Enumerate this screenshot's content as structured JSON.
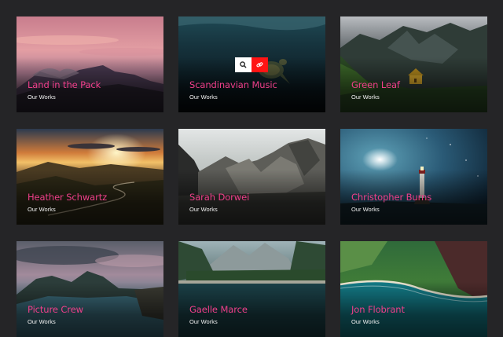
{
  "colors": {
    "background": "#252527",
    "title": "#ef3f8a",
    "subtitle": "#f2f2f2",
    "link_button": "#ff1414"
  },
  "portfolio": {
    "items": [
      {
        "title": "Land in the Pack",
        "category": "Our Works",
        "image": "pink-sunset-mountains"
      },
      {
        "title": "Scandinavian Music",
        "category": "Our Works",
        "image": "sea-turtle-underwater",
        "hover_actions": [
          "search-icon",
          "link-icon"
        ]
      },
      {
        "title": "Green Leaf",
        "category": "Our Works",
        "image": "valley-yellow-house"
      },
      {
        "title": "Heather Schwartz",
        "category": "Our Works",
        "image": "winding-road-sunset"
      },
      {
        "title": "Sarah Dorwei",
        "category": "Our Works",
        "image": "rocky-mountain-ridges"
      },
      {
        "title": "Christopher Burns",
        "category": "Our Works",
        "image": "lighthouse-night-sky"
      },
      {
        "title": "Picture Crew",
        "category": "Our Works",
        "image": "cloudy-coast-mountains"
      },
      {
        "title": "Gaelle Marce",
        "category": "Our Works",
        "image": "mountain-lake-forest"
      },
      {
        "title": "Jon Flobrant",
        "category": "Our Works",
        "image": "green-cliffs-beach"
      }
    ]
  }
}
